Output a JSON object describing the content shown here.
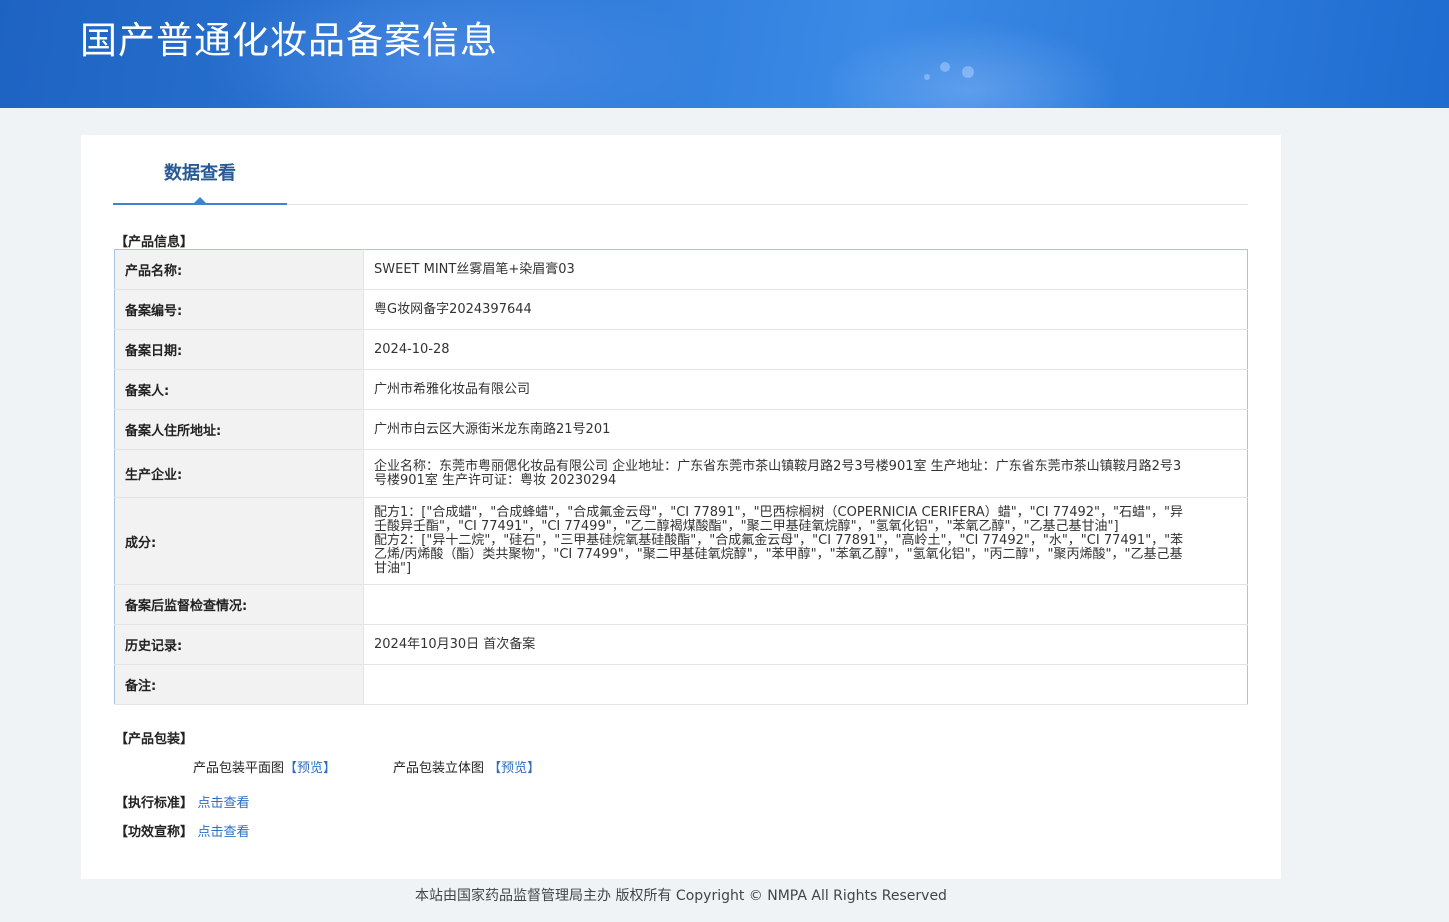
{
  "banner": {
    "title": "国产普通化妆品备案信息"
  },
  "tabs": [
    {
      "label": "数据查看",
      "active": true
    }
  ],
  "product_info": {
    "section_label": "【产品信息】",
    "rows": [
      {
        "key": "产品名称:",
        "value": "SWEET MINT丝雾眉笔+染眉膏03"
      },
      {
        "key": "备案编号:",
        "value": "粤G妆网备字2024397644"
      },
      {
        "key": "备案日期:",
        "value": "2024-10-28"
      },
      {
        "key": "备案人:",
        "value": "广州市希雅化妆品有限公司"
      },
      {
        "key": "备案人住所地址:",
        "value": "广州市白云区大源街米龙东南路21号201"
      },
      {
        "key": "生产企业:",
        "value": "企业名称：东莞市粤丽偲化妆品有限公司 企业地址：广东省东莞市茶山镇鞍月路2号3号楼901室 生产地址：广东省东莞市茶山镇鞍月路2号3号楼901室 生产许可证：粤妆 20230294"
      },
      {
        "key": "成分:",
        "value_lines": [
          "配方1：[\"合成蜡\"，\"合成蜂蜡\"，\"合成氟金云母\"，\"CI 77891\"，\"巴西棕榈树（COPERNICIA CERIFERA）蜡\"，\"CI 77492\"，\"石蜡\"，\"异壬酸异壬酯\"，\"CI 77491\"，\"CI 77499\"，\"乙二醇褐煤酸酯\"，\"聚二甲基硅氧烷醇\"，\"氢氧化铝\"，\"苯氧乙醇\"，\"乙基己基甘油\"]",
          "配方2：[\"异十二烷\"，\"硅石\"，\"三甲基硅烷氧基硅酸酯\"，\"合成氟金云母\"，\"CI 77891\"，\"高岭土\"，\"CI 77492\"，\"水\"，\"CI 77491\"，\"苯乙烯/丙烯酸（酯）类共聚物\"，\"CI 77499\"，\"聚二甲基硅氧烷醇\"，\"苯甲醇\"，\"苯氧乙醇\"，\"氢氧化铝\"，\"丙二醇\"，\"聚丙烯酸\"，\"乙基己基甘油\"]"
        ]
      },
      {
        "key": "备案后监督检查情况:",
        "value": ""
      },
      {
        "key": "历史记录:",
        "value": "2024年10月30日 首次备案"
      },
      {
        "key": "备注:",
        "value": ""
      }
    ]
  },
  "packaging": {
    "section_label": "【产品包装】",
    "flat_label": "产品包装平面图",
    "flat_link": "【预览】",
    "stereo_label": "产品包装立体图",
    "stereo_link": "【预览】"
  },
  "standard": {
    "label": "【执行标准】",
    "link": "点击查看"
  },
  "efficacy": {
    "label": "【功效宣称】",
    "link": "点击查看"
  },
  "footer": {
    "text": "本站由国家药品监督管理局主办 版权所有 Copyright © NMPA All Rights Reserved"
  }
}
